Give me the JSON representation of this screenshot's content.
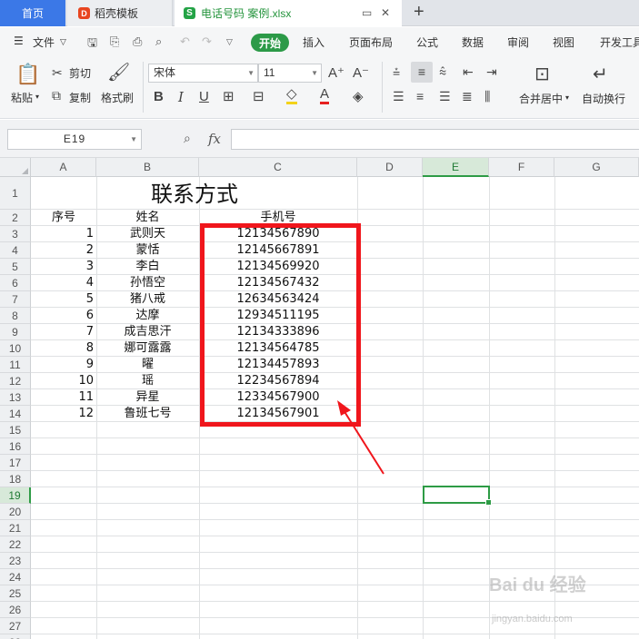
{
  "tabs": {
    "home": "首页",
    "template": "稻壳模板",
    "file": "电话号码 案例.xlsx"
  },
  "menu": [
    "文件",
    "开始",
    "插入",
    "页面布局",
    "公式",
    "数据",
    "审阅",
    "视图",
    "开发工具"
  ],
  "ribbon": {
    "paste": "粘贴",
    "cut": "剪切",
    "copy": "复制",
    "format_painter": "格式刷",
    "font_name": "宋体",
    "font_size": "11",
    "merge_center": "合并居中",
    "wrap_text": "自动换行"
  },
  "formula_bar": {
    "name_box": "E19",
    "fx_label": "fx",
    "formula": ""
  },
  "columns": [
    "A",
    "B",
    "C",
    "D",
    "E",
    "F",
    "G"
  ],
  "selected_cell": "E19",
  "sheet": {
    "title": "联系方式",
    "headers": [
      "序号",
      "姓名",
      "手机号"
    ],
    "rows": [
      [
        "1",
        "武则天",
        "12134567890"
      ],
      [
        "2",
        "蒙恬",
        "12145667891"
      ],
      [
        "3",
        "李白",
        "12134569920"
      ],
      [
        "4",
        "孙悟空",
        "12134567432"
      ],
      [
        "5",
        "猪八戒",
        "12634563424"
      ],
      [
        "6",
        "达摩",
        "12934511195"
      ],
      [
        "7",
        "成吉思汗",
        "12134333896"
      ],
      [
        "8",
        "娜可露露",
        "12134564785"
      ],
      [
        "9",
        "曜",
        "12134457893"
      ],
      [
        "10",
        "瑶",
        "12234567894"
      ],
      [
        "11",
        "异星",
        "12334567900"
      ],
      [
        "12",
        "鲁班七号",
        "12134567901"
      ]
    ]
  },
  "watermark": {
    "brand": "Bai du 经验",
    "url": "jingyan.baidu.com"
  },
  "colors": {
    "accent_green": "#2d9b45",
    "highlight_red": "#f0161c",
    "home_tab_blue": "#3b78e7"
  }
}
